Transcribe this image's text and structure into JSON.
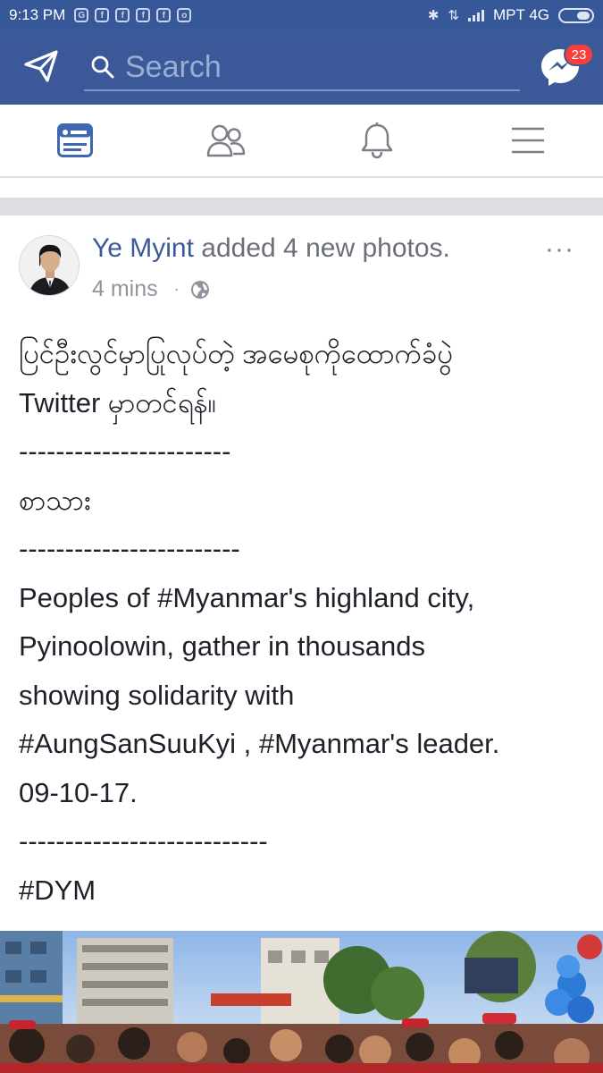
{
  "status_bar": {
    "time": "9:13 PM",
    "notification_icons": [
      "G",
      "f",
      "f",
      "f",
      "f",
      "o"
    ],
    "carrier": "MPT 4G",
    "bluetooth_glyph": "✱",
    "data_glyph": "⇅"
  },
  "app_bar": {
    "search_placeholder": "Search",
    "messenger_badge": "23"
  },
  "nav_tabs": [
    {
      "id": "news-feed",
      "icon": "news-feed-icon",
      "active": true
    },
    {
      "id": "friends",
      "icon": "friends-icon",
      "active": false
    },
    {
      "id": "notifications",
      "icon": "bell-icon",
      "active": false
    },
    {
      "id": "menu",
      "icon": "hamburger-menu-icon",
      "active": false
    }
  ],
  "post": {
    "author": "Ye Myint",
    "action": "added 4 new photos.",
    "timestamp": "4 mins",
    "meta_separator": "·",
    "privacy_icon": "globe-icon",
    "more_label": "···",
    "lines": [
      "ပြင်ဦးလွင်မှာပြုလုပ်တဲ့ အမေစုကိုထောက်ခံပွဲ",
      "Twitter မှာတင်ရန်။",
      "-----------------------",
      "စာသား",
      "------------------------",
      "Peoples of #Myanmar's highland city,",
      "Pyinoolowin, gather in thousands",
      "showing solidarity with",
      "#AungSanSuuKyi , #Myanmar's leader.",
      "09-10-17.",
      "---------------------------",
      "#DYM"
    ]
  },
  "colors": {
    "brand_blue": "#3b5998",
    "status_blue": "#365899",
    "badge_red": "#fa3e3e",
    "link_blue": "#3b5998",
    "meta_gray": "#90949c"
  }
}
